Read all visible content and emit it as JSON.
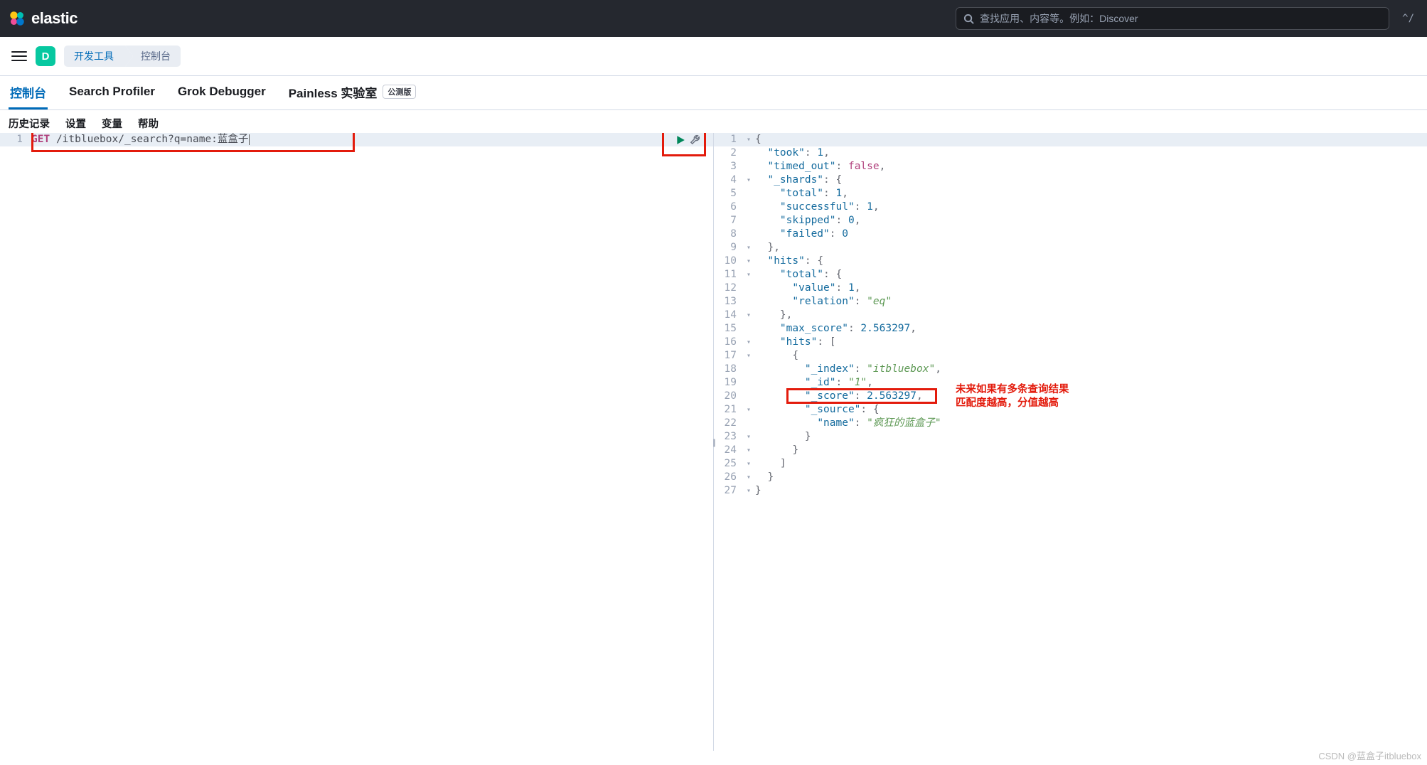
{
  "header": {
    "brand": "elastic",
    "search_placeholder": "查找应用、内容等。例如：Discover",
    "shortcut": "^/"
  },
  "nav": {
    "space_letter": "D",
    "breadcrumbs": [
      "开发工具",
      "控制台"
    ]
  },
  "tabs": {
    "items": [
      "控制台",
      "Search Profiler",
      "Grok Debugger",
      "Painless 实验室"
    ],
    "beta_label": "公测版",
    "active_index": 0
  },
  "toolbar": {
    "items": [
      "历史记录",
      "设置",
      "变量",
      "帮助"
    ]
  },
  "request": {
    "line_no": "1",
    "method": "GET",
    "path": "/itbluebox/_search?q=name:蓝盒子"
  },
  "response": {
    "lines": [
      {
        "n": "1",
        "fold": "▾",
        "indent": 0,
        "tokens": [
          {
            "t": "{",
            "c": "punc"
          }
        ]
      },
      {
        "n": "2",
        "fold": "",
        "indent": 1,
        "tokens": [
          {
            "t": "\"took\"",
            "c": "key"
          },
          {
            "t": ": ",
            "c": "punc"
          },
          {
            "t": "1",
            "c": "num"
          },
          {
            "t": ",",
            "c": "punc"
          }
        ]
      },
      {
        "n": "3",
        "fold": "",
        "indent": 1,
        "tokens": [
          {
            "t": "\"timed_out\"",
            "c": "key"
          },
          {
            "t": ": ",
            "c": "punc"
          },
          {
            "t": "false",
            "c": "bool"
          },
          {
            "t": ",",
            "c": "punc"
          }
        ]
      },
      {
        "n": "4",
        "fold": "▾",
        "indent": 1,
        "tokens": [
          {
            "t": "\"_shards\"",
            "c": "key"
          },
          {
            "t": ": {",
            "c": "punc"
          }
        ]
      },
      {
        "n": "5",
        "fold": "",
        "indent": 2,
        "tokens": [
          {
            "t": "\"total\"",
            "c": "key"
          },
          {
            "t": ": ",
            "c": "punc"
          },
          {
            "t": "1",
            "c": "num"
          },
          {
            "t": ",",
            "c": "punc"
          }
        ]
      },
      {
        "n": "6",
        "fold": "",
        "indent": 2,
        "tokens": [
          {
            "t": "\"successful\"",
            "c": "key"
          },
          {
            "t": ": ",
            "c": "punc"
          },
          {
            "t": "1",
            "c": "num"
          },
          {
            "t": ",",
            "c": "punc"
          }
        ]
      },
      {
        "n": "7",
        "fold": "",
        "indent": 2,
        "tokens": [
          {
            "t": "\"skipped\"",
            "c": "key"
          },
          {
            "t": ": ",
            "c": "punc"
          },
          {
            "t": "0",
            "c": "num"
          },
          {
            "t": ",",
            "c": "punc"
          }
        ]
      },
      {
        "n": "8",
        "fold": "",
        "indent": 2,
        "tokens": [
          {
            "t": "\"failed\"",
            "c": "key"
          },
          {
            "t": ": ",
            "c": "punc"
          },
          {
            "t": "0",
            "c": "num"
          }
        ]
      },
      {
        "n": "9",
        "fold": "▾",
        "indent": 1,
        "tokens": [
          {
            "t": "},",
            "c": "punc"
          }
        ]
      },
      {
        "n": "10",
        "fold": "▾",
        "indent": 1,
        "tokens": [
          {
            "t": "\"hits\"",
            "c": "key"
          },
          {
            "t": ": {",
            "c": "punc"
          }
        ]
      },
      {
        "n": "11",
        "fold": "▾",
        "indent": 2,
        "tokens": [
          {
            "t": "\"total\"",
            "c": "key"
          },
          {
            "t": ": {",
            "c": "punc"
          }
        ]
      },
      {
        "n": "12",
        "fold": "",
        "indent": 3,
        "tokens": [
          {
            "t": "\"value\"",
            "c": "key"
          },
          {
            "t": ": ",
            "c": "punc"
          },
          {
            "t": "1",
            "c": "num"
          },
          {
            "t": ",",
            "c": "punc"
          }
        ]
      },
      {
        "n": "13",
        "fold": "",
        "indent": 3,
        "tokens": [
          {
            "t": "\"relation\"",
            "c": "key"
          },
          {
            "t": ": ",
            "c": "punc"
          },
          {
            "t": "\"eq\"",
            "c": "green"
          }
        ]
      },
      {
        "n": "14",
        "fold": "▾",
        "indent": 2,
        "tokens": [
          {
            "t": "},",
            "c": "punc"
          }
        ]
      },
      {
        "n": "15",
        "fold": "",
        "indent": 2,
        "tokens": [
          {
            "t": "\"max_score\"",
            "c": "key"
          },
          {
            "t": ": ",
            "c": "punc"
          },
          {
            "t": "2.563297",
            "c": "num"
          },
          {
            "t": ",",
            "c": "punc"
          }
        ]
      },
      {
        "n": "16",
        "fold": "▾",
        "indent": 2,
        "tokens": [
          {
            "t": "\"hits\"",
            "c": "key"
          },
          {
            "t": ": [",
            "c": "punc"
          }
        ]
      },
      {
        "n": "17",
        "fold": "▾",
        "indent": 3,
        "tokens": [
          {
            "t": "{",
            "c": "punc"
          }
        ]
      },
      {
        "n": "18",
        "fold": "",
        "indent": 4,
        "tokens": [
          {
            "t": "\"_index\"",
            "c": "key"
          },
          {
            "t": ": ",
            "c": "punc"
          },
          {
            "t": "\"itbluebox\"",
            "c": "green"
          },
          {
            "t": ",",
            "c": "punc"
          }
        ]
      },
      {
        "n": "19",
        "fold": "",
        "indent": 4,
        "tokens": [
          {
            "t": "\"_id\"",
            "c": "key"
          },
          {
            "t": ": ",
            "c": "punc"
          },
          {
            "t": "\"1\"",
            "c": "green"
          },
          {
            "t": ",",
            "c": "punc"
          }
        ]
      },
      {
        "n": "20",
        "fold": "",
        "indent": 4,
        "tokens": [
          {
            "t": "\"_score\"",
            "c": "key"
          },
          {
            "t": ": ",
            "c": "punc"
          },
          {
            "t": "2.563297",
            "c": "num"
          },
          {
            "t": ",",
            "c": "punc"
          }
        ]
      },
      {
        "n": "21",
        "fold": "▾",
        "indent": 4,
        "tokens": [
          {
            "t": "\"_source\"",
            "c": "key"
          },
          {
            "t": ": {",
            "c": "punc"
          }
        ]
      },
      {
        "n": "22",
        "fold": "",
        "indent": 5,
        "tokens": [
          {
            "t": "\"name\"",
            "c": "key"
          },
          {
            "t": ": ",
            "c": "punc"
          },
          {
            "t": "\"疯狂的蓝盒子\"",
            "c": "green"
          }
        ]
      },
      {
        "n": "23",
        "fold": "▾",
        "indent": 4,
        "tokens": [
          {
            "t": "}",
            "c": "punc"
          }
        ]
      },
      {
        "n": "24",
        "fold": "▾",
        "indent": 3,
        "tokens": [
          {
            "t": "}",
            "c": "punc"
          }
        ]
      },
      {
        "n": "25",
        "fold": "▾",
        "indent": 2,
        "tokens": [
          {
            "t": "]",
            "c": "punc"
          }
        ]
      },
      {
        "n": "26",
        "fold": "▾",
        "indent": 1,
        "tokens": [
          {
            "t": "}",
            "c": "punc"
          }
        ]
      },
      {
        "n": "27",
        "fold": "▾",
        "indent": 0,
        "tokens": [
          {
            "t": "}",
            "c": "punc"
          }
        ]
      }
    ]
  },
  "annotation": {
    "line1": "未来如果有多条查询结果",
    "line2": "匹配度越高，分值越高"
  },
  "watermark": "CSDN @蓝盒子itbluebox"
}
